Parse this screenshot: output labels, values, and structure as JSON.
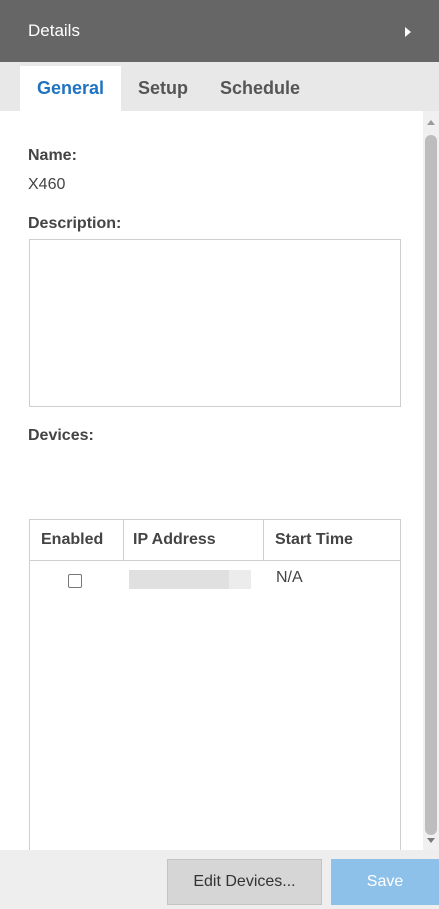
{
  "panel": {
    "title": "Details",
    "collapse_icon": "caret-right-icon"
  },
  "tabs": [
    {
      "label": "General",
      "active": true
    },
    {
      "label": "Setup",
      "active": false
    },
    {
      "label": "Schedule",
      "active": false
    }
  ],
  "general": {
    "name_label": "Name:",
    "name_value": "X460",
    "description_label": "Description:",
    "description_value": "",
    "devices_label": "Devices:"
  },
  "devices_table": {
    "columns": [
      "Enabled",
      "IP Address",
      "Start Time"
    ],
    "rows": [
      {
        "enabled": false,
        "ip_address": "",
        "start_time": "N/A"
      }
    ]
  },
  "footer": {
    "edit_devices_label": "Edit Devices...",
    "save_label": "Save"
  },
  "colors": {
    "accent": "#1f73c1",
    "header_bg": "#666666",
    "save_bg": "#8ec1ea"
  }
}
